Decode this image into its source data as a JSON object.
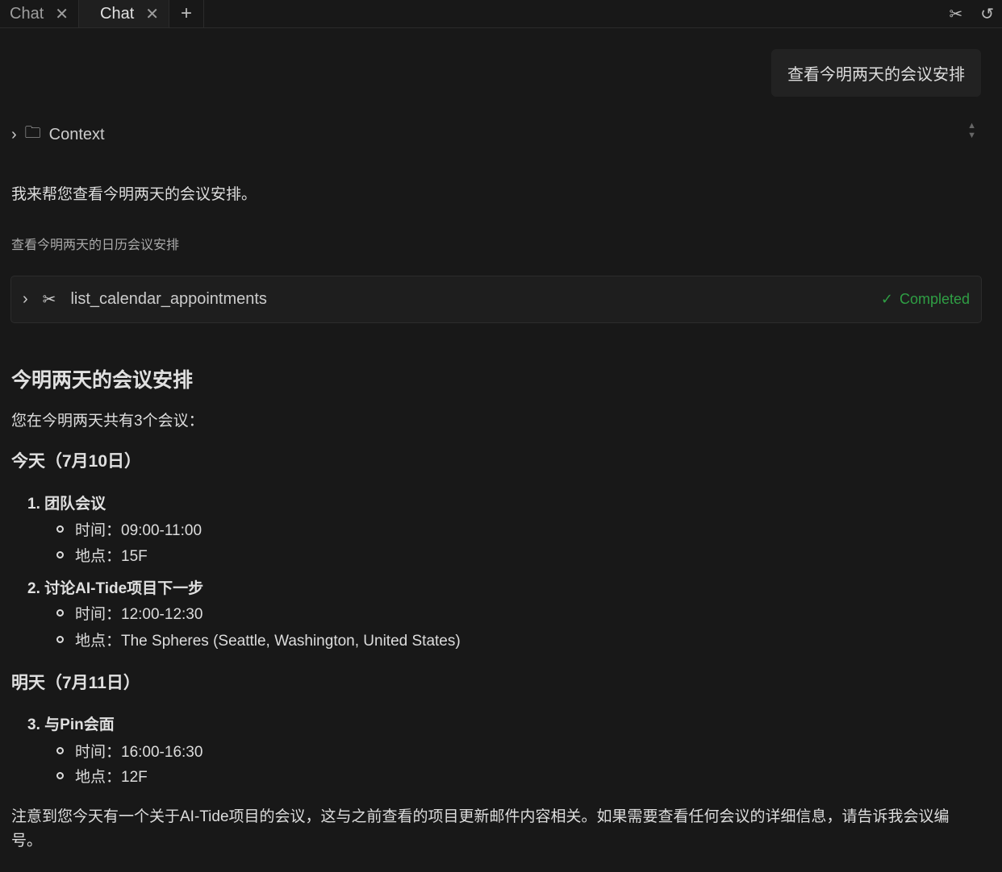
{
  "tabs": [
    {
      "label": "Chat"
    },
    {
      "label": "Chat"
    }
  ],
  "user_message": "查看今明两天的会议安排",
  "context_label": "Context",
  "intro": "我来帮您查看今明两天的会议安排。",
  "tool_caption": "查看今明两天的日历会议安排",
  "tool": {
    "name": "list_calendar_appointments",
    "status": "Completed"
  },
  "heading": "今明两天的会议安排",
  "summary": "您在今明两天共有3个会议：",
  "days": [
    {
      "title": "今天（7月10日）",
      "meetings": [
        {
          "num": "1.",
          "title": "团队会议",
          "time": "时间：09:00-11:00",
          "place": "地点：15F"
        },
        {
          "num": "2.",
          "title": "讨论AI-Tide项目下一步",
          "time": "时间：12:00-12:30",
          "place": "地点：The Spheres (Seattle, Washington, United States)"
        }
      ]
    },
    {
      "title": "明天（7月11日）",
      "meetings": [
        {
          "num": "3.",
          "title": "与Pin会面",
          "time": "时间：16:00-16:30",
          "place": "地点：12F"
        }
      ]
    }
  ],
  "footer": "注意到您今天有一个关于AI-Tide项目的会议，这与之前查看的项目更新邮件内容相关。如果需要查看任何会议的详细信息，请告诉我会议编号。"
}
